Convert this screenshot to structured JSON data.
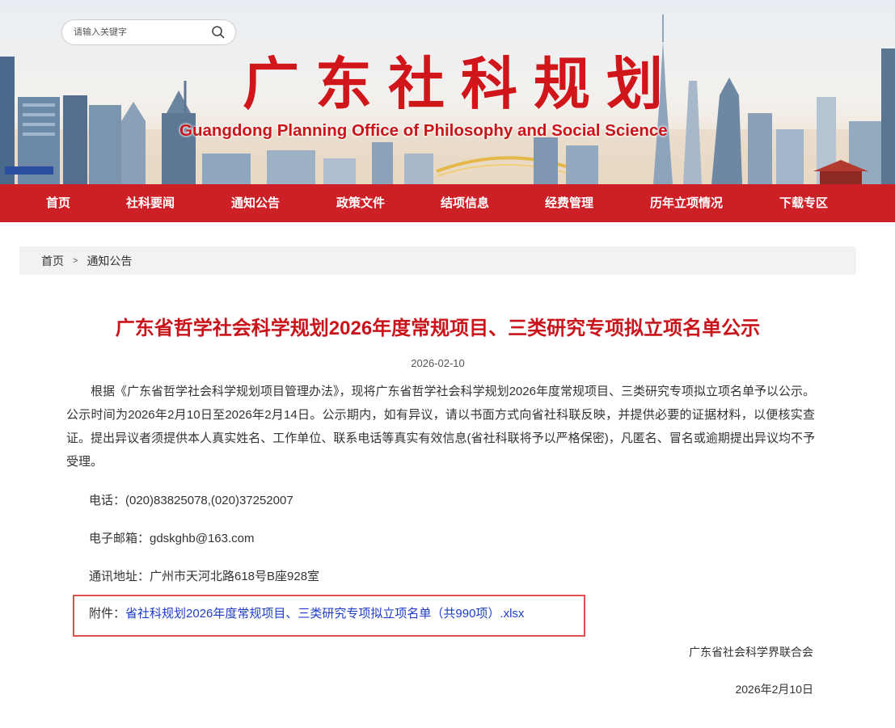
{
  "header": {
    "search_placeholder": "请输入关键字",
    "site_title": "广东社科规划",
    "site_subtitle": "Guangdong Planning Office of Philosophy and Social Science"
  },
  "nav": {
    "items": [
      "首页",
      "社科要闻",
      "通知公告",
      "政策文件",
      "结项信息",
      "经费管理",
      "历年立项情况",
      "下载专区"
    ]
  },
  "breadcrumb": {
    "home": "首页",
    "separator": ">",
    "current": "通知公告"
  },
  "article": {
    "title": "广东省哲学社会科学规划2026年度常规项目、三类研究专项拟立项名单公示",
    "date": "2026-02-10",
    "body": "根据《广东省哲学社会科学规划项目管理办法》，现将广东省哲学社会科学规划2026年度常规项目、三类研究专项拟立项名单予以公示。公示时间为2026年2月10日至2026年2月14日。公示期内，如有异议，请以书面方式向省社科联反映，并提供必要的证据材料，以便核实查证。提出异议者须提供本人真实姓名、工作单位、联系电话等真实有效信息(省社科联将予以严格保密)，凡匿名、冒名或逾期提出异议均不予受理。",
    "phone": "电话：(020)83825078,(020)37252007",
    "email": "电子邮箱：gdskghb@163.com",
    "address": "通讯地址：广州市天河北路618号B座928室",
    "attachment_label": "附件：",
    "attachment_link": "省社科规划2026年度常规项目、三类研究专项拟立项名单（共990项）.xlsx",
    "signature_org": "广东省社会科学界联合会",
    "signature_date": "2026年2月10日"
  },
  "colors": {
    "brand_red": "#cc1f26",
    "title_red": "#c8141a",
    "link_blue": "#1e3ec8",
    "highlight_border": "#e0504f"
  }
}
